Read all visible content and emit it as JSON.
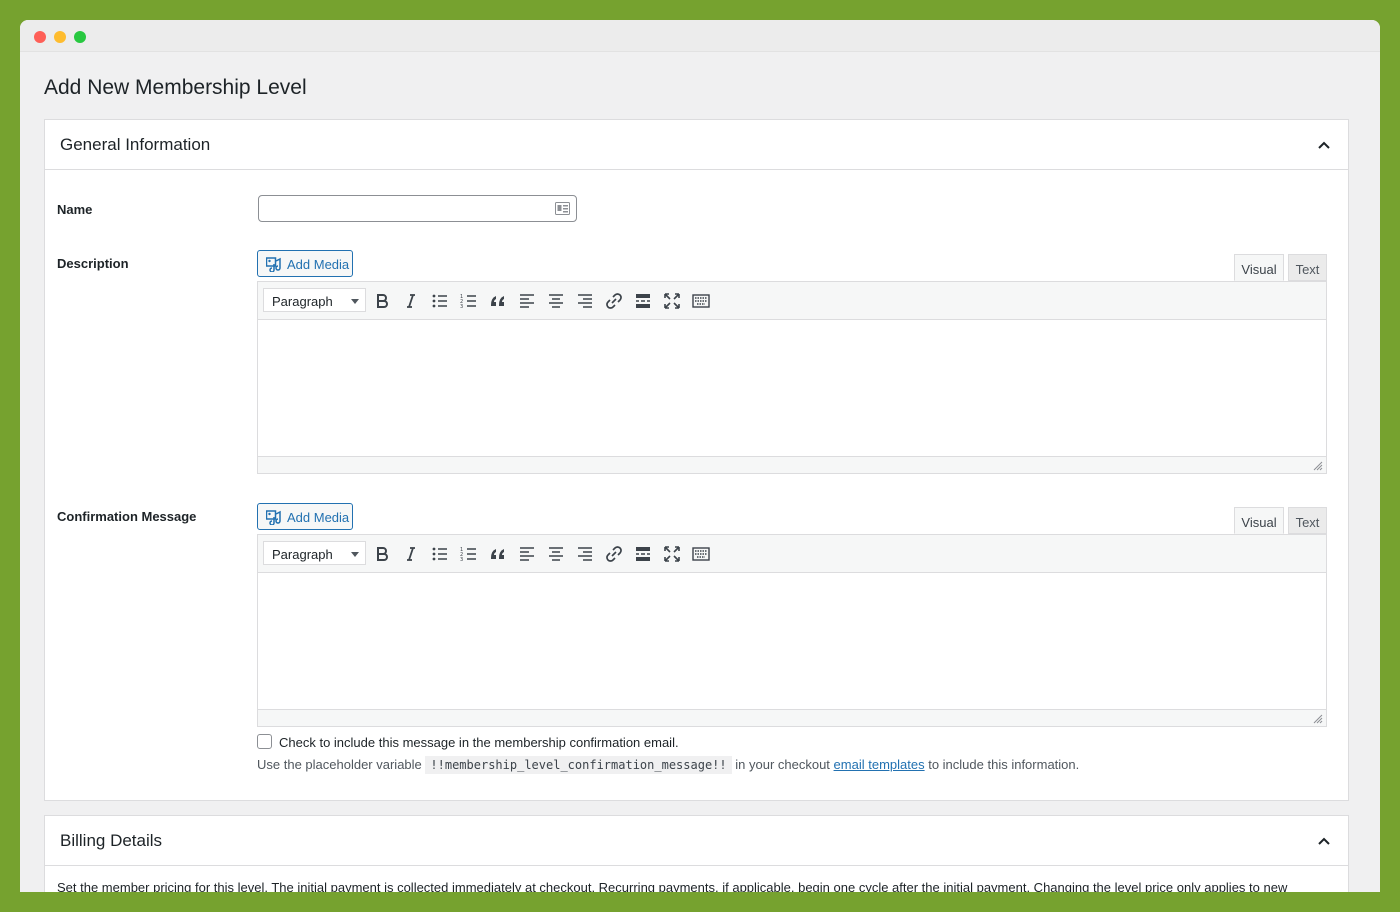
{
  "page": {
    "title": "Add New Membership Level"
  },
  "general": {
    "title": "General Information",
    "name_label": "Name",
    "name_value": "",
    "description_label": "Description",
    "confirmation_label": "Confirmation Message",
    "add_media_label": "Add Media",
    "tab_visual": "Visual",
    "tab_text": "Text",
    "format_select": "Paragraph",
    "toolbar_icons": [
      "bold-icon",
      "italic-icon",
      "bullet-list-icon",
      "numbered-list-icon",
      "blockquote-icon",
      "align-left-icon",
      "align-center-icon",
      "align-right-icon",
      "link-icon",
      "read-more-icon",
      "fullscreen-icon",
      "toolbar-toggle-icon"
    ],
    "include_checkbox_label": "Check to include this message in the membership confirmation email.",
    "hint_prefix": "Use the placeholder variable",
    "hint_code": "!!membership_level_confirmation_message!!",
    "hint_middle": "in your checkout",
    "hint_link": "email templates",
    "hint_suffix": "to include this information."
  },
  "billing": {
    "title": "Billing Details",
    "description": "Set the member pricing for this level. The initial payment is collected immediately at checkout. Recurring payments, if applicable, begin one cycle after the initial payment. Changing the level price only applies to new"
  },
  "colors": {
    "background": "#76a22f",
    "accent": "#2271b1"
  }
}
